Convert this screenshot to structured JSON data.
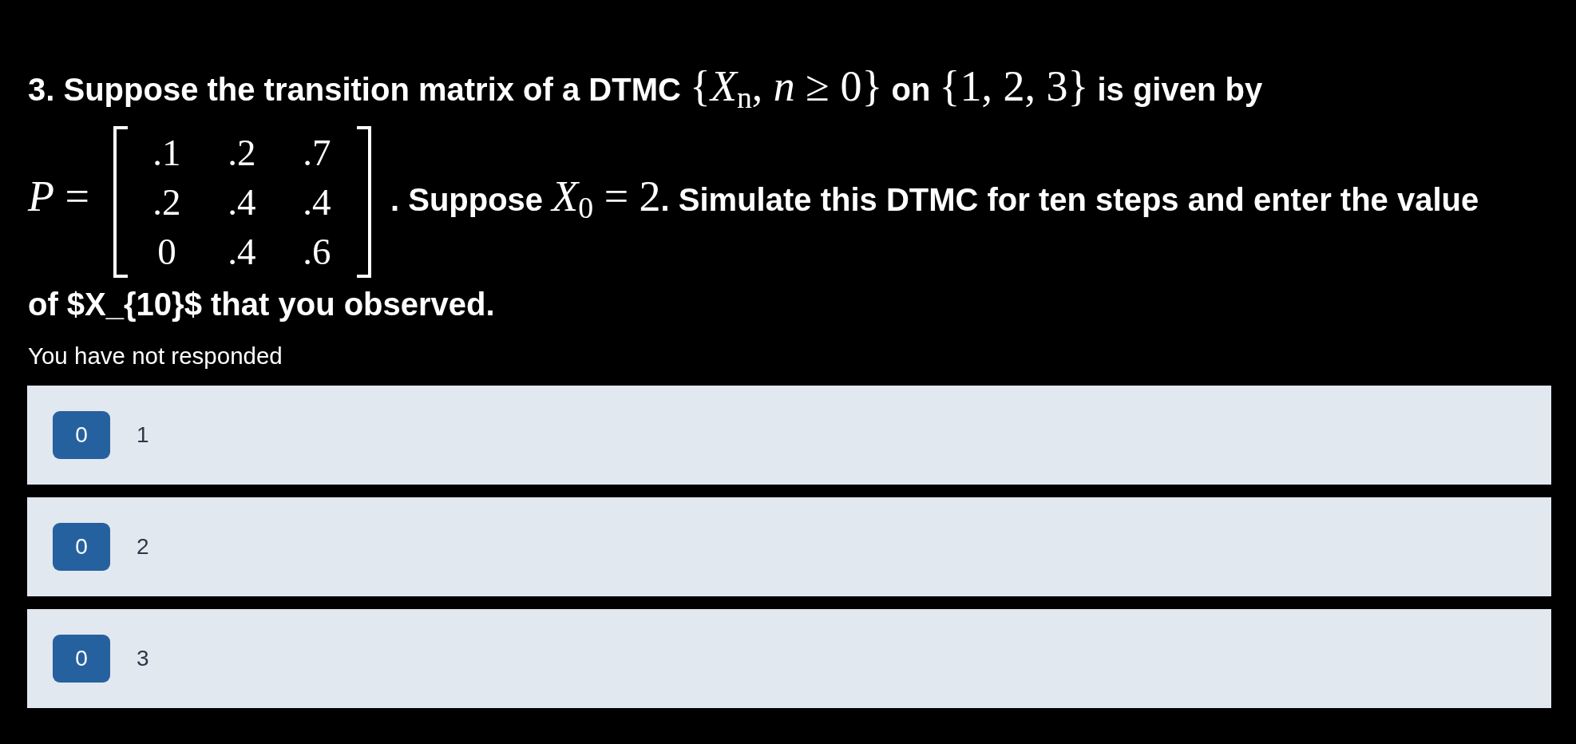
{
  "question": {
    "lines": [
      [
        {
          "kind": "text",
          "text": "3. Suppose the transition matrix of a DTMC "
        },
        {
          "kind": "math",
          "text": "{*X*$_{n}$, *n* ≥ 0}"
        },
        {
          "kind": "text",
          "text": " on "
        },
        {
          "kind": "math",
          "text": "{1, 2, 3}"
        },
        {
          "kind": "text",
          "text": " is given by"
        }
      ],
      [
        {
          "kind": "math",
          "text": "*P* ="
        },
        {
          "kind": "matrix",
          "rows": [
            [
              ".1",
              ".2",
              ".7"
            ],
            [
              ".2",
              ".4",
              ".4"
            ],
            [
              "0",
              ".4",
              ".6"
            ]
          ]
        },
        {
          "kind": "text",
          "text": ". Suppose "
        },
        {
          "kind": "math",
          "text": "*X*$_{0}$ = 2"
        },
        {
          "kind": "text",
          "text": ". Simulate this DTMC for ten steps and enter the value"
        }
      ],
      [
        {
          "kind": "text",
          "text": "of $X_{10}$ that you observed."
        }
      ]
    ]
  },
  "status": "You have not responded",
  "options": [
    {
      "count": "0",
      "label": "1"
    },
    {
      "count": "0",
      "label": "2"
    },
    {
      "count": "0",
      "label": "3"
    }
  ]
}
